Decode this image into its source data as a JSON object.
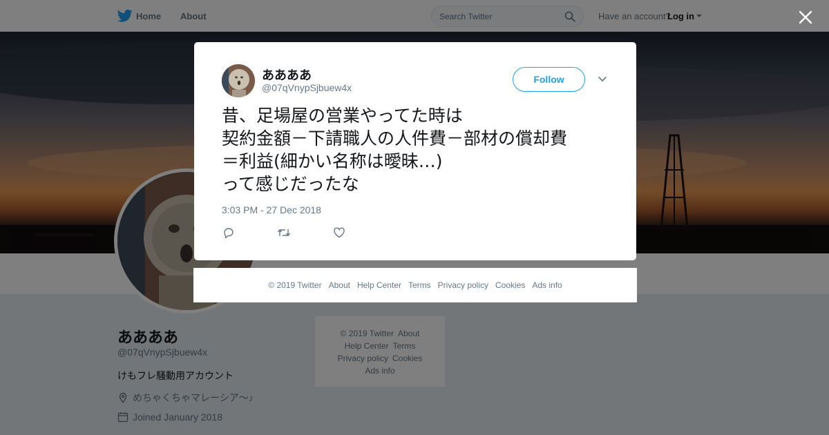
{
  "nav": {
    "home_label": "Home",
    "about_label": "About",
    "search_placeholder": "Search Twitter",
    "account_prompt": "Have an account?",
    "login_label": "Log in"
  },
  "profile": {
    "name": "ああああ",
    "handle": "@07qVnypSjbuew4x",
    "bio": "けもフレ騒動用アカウント",
    "location": "めちゃくちゃマレーシア～♪",
    "joined": "Joined January 2018"
  },
  "side_footer": {
    "row1a": "© 2019 Twitter",
    "row1b": "About",
    "row2a": "Help Center",
    "row2b": "Terms",
    "row3a": "Privacy policy",
    "row3b": "Cookies",
    "row4": "Ads info"
  },
  "tweet": {
    "name": "ああああ",
    "handle": "@07qVnypSjbuew4x",
    "follow_label": "Follow",
    "lines": [
      "昔、足場屋の営業やってた時は",
      "契約金額－下請職人の人件費－部材の償却費",
      "＝利益(細かい名称は曖昧…)",
      "って感じだったな"
    ],
    "timestamp": "3:03 PM - 27 Dec 2018"
  },
  "modal_footer": {
    "copyright": "© 2019 Twitter",
    "about": "About",
    "help": "Help Center",
    "terms": "Terms",
    "privacy": "Privacy policy",
    "cookies": "Cookies",
    "ads": "Ads info"
  },
  "colors": {
    "brand": "#1da1f2",
    "secondary_text": "#657786",
    "page_bg": "#e6ecf0"
  },
  "icons": [
    "twitter-bird-icon",
    "search-icon",
    "caret-down-icon",
    "close-icon",
    "chevron-down-icon",
    "reply-icon",
    "retweet-icon",
    "like-icon",
    "location-icon",
    "calendar-icon"
  ]
}
